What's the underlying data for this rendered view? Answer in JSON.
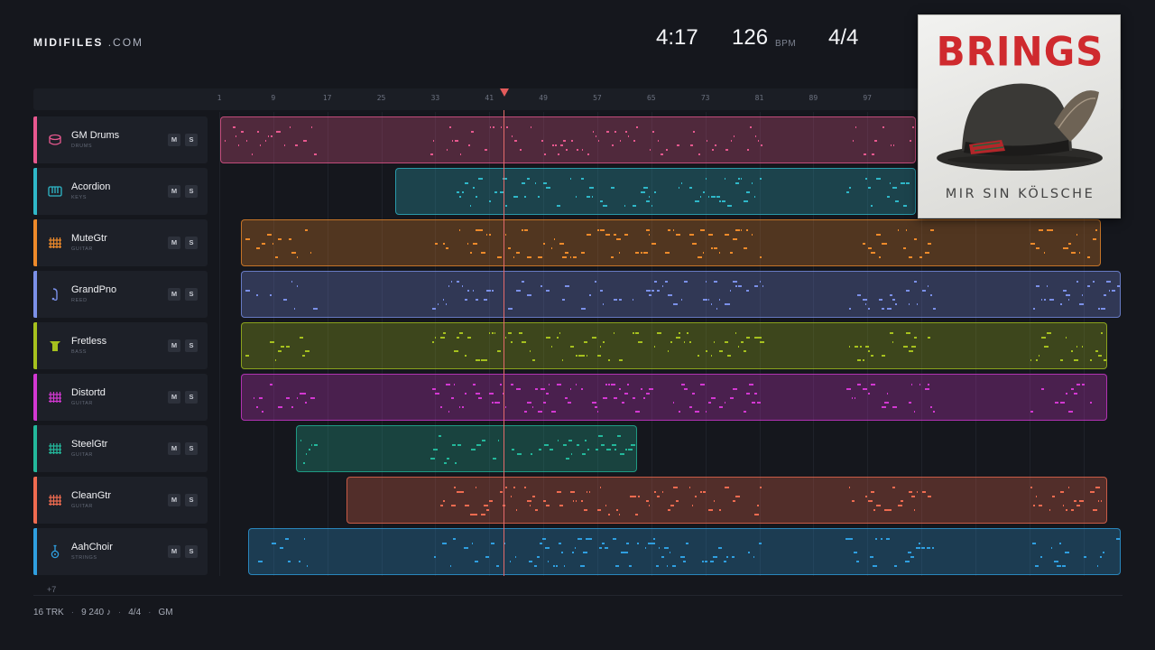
{
  "header": {
    "brand_main": "MIDIFILES",
    "brand_suffix": ".COM",
    "duration": "4:17",
    "tempo": "126",
    "tempo_unit": "BPM",
    "time_signature": "4/4"
  },
  "ruler": {
    "ticks": [
      "1",
      "9",
      "17",
      "25",
      "33",
      "41",
      "49",
      "57",
      "65",
      "73",
      "81",
      "89",
      "97"
    ]
  },
  "tracks": [
    {
      "name": "GM Drums",
      "category": "DRUMS",
      "icon": "drum-icon",
      "color": "#e8588f",
      "mute_label": "M",
      "solo_label": "S"
    },
    {
      "name": "Acordion",
      "category": "KEYS",
      "icon": "keyboard-icon",
      "color": "#2fb8c9",
      "mute_label": "M",
      "solo_label": "S"
    },
    {
      "name": "MuteGtr",
      "category": "GUITAR",
      "icon": "fretboard-icon",
      "color": "#ee8a2a",
      "mute_label": "M",
      "solo_label": "S"
    },
    {
      "name": "GrandPno",
      "category": "REED",
      "icon": "reed-icon",
      "color": "#7b90e8",
      "mute_label": "M",
      "solo_label": "S"
    },
    {
      "name": "Fretless",
      "category": "BASS",
      "icon": "bass-icon",
      "color": "#a6c11e",
      "mute_label": "M",
      "solo_label": "S"
    },
    {
      "name": "Distortd",
      "category": "GUITAR",
      "icon": "fretboard-icon",
      "color": "#d338d2",
      "mute_label": "M",
      "solo_label": "S"
    },
    {
      "name": "SteelGtr",
      "category": "GUITAR",
      "icon": "fretboard-icon",
      "color": "#23b89b",
      "mute_label": "M",
      "solo_label": "S"
    },
    {
      "name": "CleanGtr",
      "category": "GUITAR",
      "icon": "fretboard-icon",
      "color": "#ef6b50",
      "mute_label": "M",
      "solo_label": "S"
    },
    {
      "name": "AahChoir",
      "category": "STRINGS",
      "icon": "acoustic-guitar-icon",
      "color": "#2f9fe0",
      "mute_label": "M",
      "solo_label": "S"
    }
  ],
  "more_tracks": "+7",
  "footer": {
    "tracks": "16 TRK",
    "notes": "9 240 ♪",
    "time_signature": "4/4",
    "standard": "GM"
  },
  "album": {
    "artist": "BRINGS",
    "title": "MIR SIN KÖLSCHE"
  }
}
